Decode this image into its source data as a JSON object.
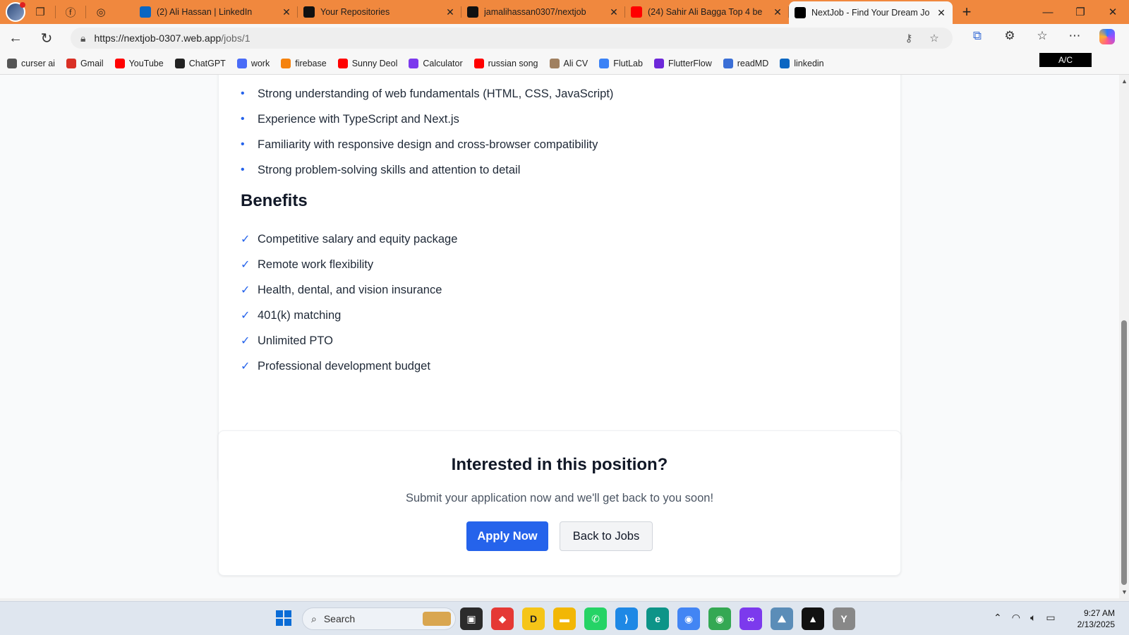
{
  "browser": {
    "tabs": [
      {
        "title": "(2) Ali Hassan | LinkedIn",
        "favicon": "linkedin-icon",
        "color": "#0a66c2"
      },
      {
        "title": "Your Repositories",
        "favicon": "github-icon",
        "color": "#111111"
      },
      {
        "title": "jamalihassan0307/nextjob",
        "favicon": "github-icon",
        "color": "#111111"
      },
      {
        "title": "(24) Sahir Ali Bagga Top 4 be",
        "favicon": "youtube-icon",
        "color": "#ff0000"
      },
      {
        "title": "NextJob - Find Your Dream Job",
        "favicon": "nextjs-icon",
        "color": "#000000",
        "active": true
      }
    ],
    "url_host": "https://nextjob-0307.web.app",
    "url_path": "/jobs/1",
    "bookmarks": [
      {
        "label": "curser ai",
        "color": "#555555"
      },
      {
        "label": "Gmail",
        "color": "#d93025"
      },
      {
        "label": "YouTube",
        "color": "#ff0000"
      },
      {
        "label": "ChatGPT",
        "color": "#222222"
      },
      {
        "label": "work",
        "color": "#4a6cf7"
      },
      {
        "label": "firebase",
        "color": "#f5820d"
      },
      {
        "label": "Sunny Deol",
        "color": "#ff0000"
      },
      {
        "label": "Calculator",
        "color": "#7c3aed"
      },
      {
        "label": "russian song",
        "color": "#ff0000"
      },
      {
        "label": "Ali CV",
        "color": "#a08060"
      },
      {
        "label": "FlutLab",
        "color": "#3b82f6"
      },
      {
        "label": "FlutterFlow",
        "color": "#6d28d9"
      },
      {
        "label": "readMD",
        "color": "#3b6fd6"
      },
      {
        "label": "linkedin",
        "color": "#0a66c2"
      }
    ],
    "badge": "A/C"
  },
  "job": {
    "requirements": [
      "Strong understanding of web fundamentals (HTML, CSS, JavaScript)",
      "Experience with TypeScript and Next.js",
      "Familiarity with responsive design and cross-browser compatibility",
      "Strong problem-solving skills and attention to detail"
    ],
    "benefits_heading": "Benefits",
    "benefits": [
      "Competitive salary and equity package",
      "Remote work flexibility",
      "Health, dental, and vision insurance",
      "401(k) matching",
      "Unlimited PTO",
      "Professional development budget"
    ]
  },
  "cta": {
    "title": "Interested in this position?",
    "subtitle": "Submit your application now and we'll get back to you soon!",
    "apply_label": "Apply Now",
    "back_label": "Back to Jobs"
  },
  "taskbar": {
    "search_placeholder": "Search",
    "time": "9:27 AM",
    "date": "2/13/2025"
  },
  "colors": {
    "accent": "#2563eb",
    "tabbar": "#f0883e"
  }
}
